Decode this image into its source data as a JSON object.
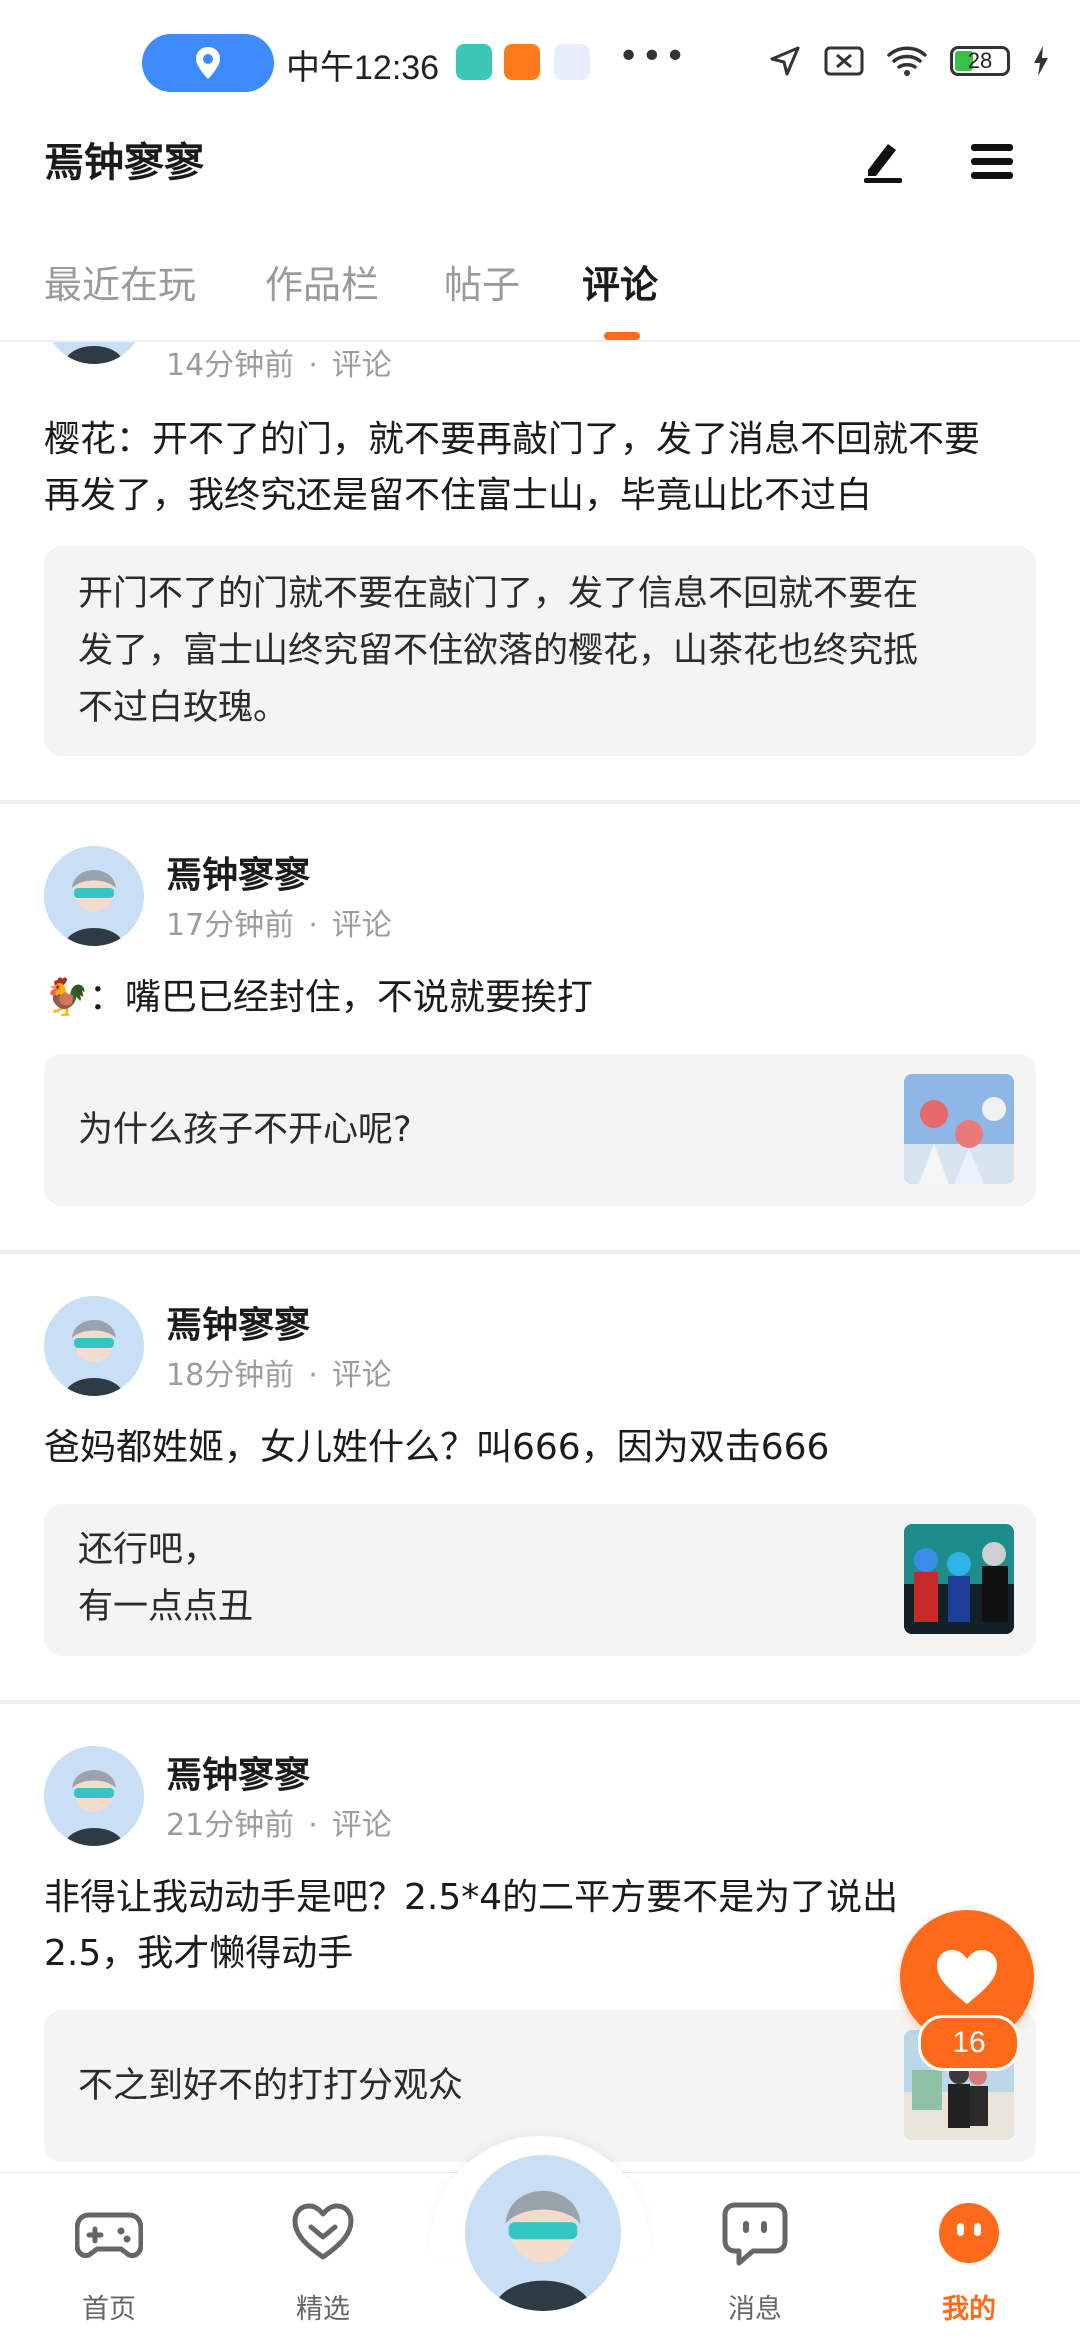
{
  "status_bar": {
    "time": "中午12:36",
    "battery": "28",
    "colors": {
      "pill": "#3d8bff",
      "battery_fill": "#37c24a"
    }
  },
  "header": {
    "title": "焉钟寥寥",
    "edit_icon": "pen-icon",
    "menu_icon": "hamburger-icon"
  },
  "tabs": [
    {
      "label": "最近在玩",
      "active": false
    },
    {
      "label": "作品栏",
      "active": false
    },
    {
      "label": "帖子",
      "active": false
    },
    {
      "label": "评论",
      "active": true
    }
  ],
  "accent_color": "#ff6a1a",
  "posts": [
    {
      "time": "14分钟前",
      "type": "评论",
      "text_lines": [
        "樱花：开不了的门，就不要再敲门了，发了消息不回就不要",
        "再发了，我终究还是留不住富士山，毕竟山比不过白"
      ],
      "quote_lines": [
        "开门不了的门就不要在敲门了，发了信息不回就不要在",
        "发了，富士山终究留不住欲落的樱花，山茶花也终究抵",
        "不过白玫瑰。"
      ]
    },
    {
      "user": "焉钟寥寥",
      "time": "17分钟前",
      "type": "评论",
      "text_emoji": "🐓",
      "text": "：嘴巴已经封住，不说就要挨打",
      "quote_lines": [
        "为什么孩子不开心呢?"
      ]
    },
    {
      "user": "焉钟寥寥",
      "time": "18分钟前",
      "type": "评论",
      "text": "爸妈都姓姬，女儿姓什么？叫666，因为双击666",
      "quote_lines": [
        "还行吧，",
        "有一点点丑"
      ]
    },
    {
      "user": "焉钟寥寥",
      "time": "21分钟前",
      "type": "评论",
      "text_lines": [
        "非得让我动动手是吧？2.5*4的二平方要不是为了说出",
        "2.5，我才懒得动手"
      ],
      "quote_lines": [
        "不之到好不的打打分观众"
      ]
    }
  ],
  "meta_separator": "·",
  "like": {
    "count": "16",
    "icon": "heart-icon"
  },
  "bottom_nav": [
    {
      "label": "首页",
      "icon": "gamepad-icon",
      "active": false
    },
    {
      "label": "精选",
      "icon": "heart-outline-icon",
      "active": false
    },
    {
      "label": "消息",
      "icon": "chat-bubble-icon",
      "active": false
    },
    {
      "label": "我的",
      "icon": "face-icon",
      "active": true
    }
  ]
}
